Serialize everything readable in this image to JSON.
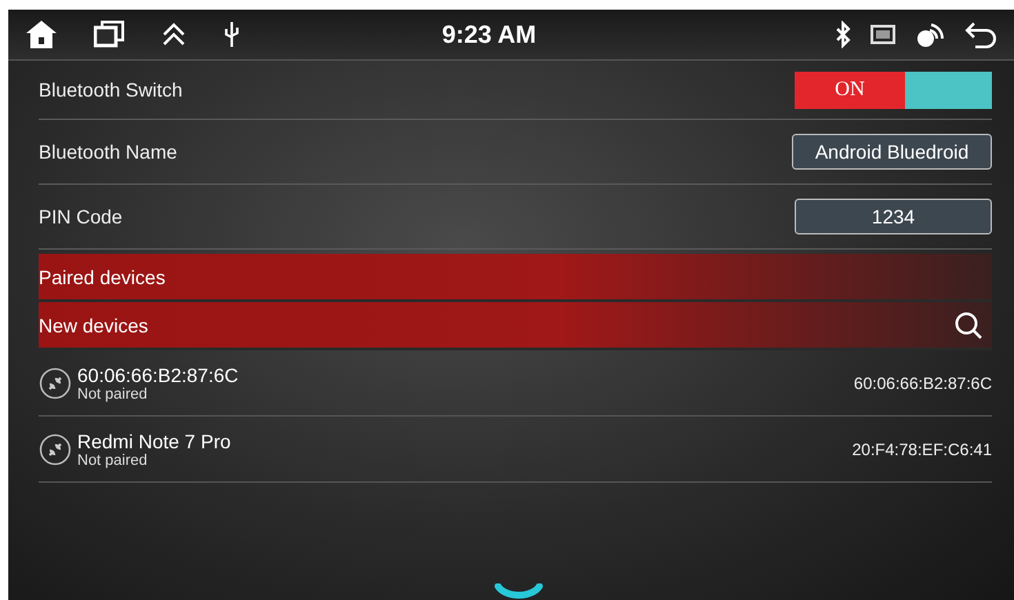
{
  "status_bar": {
    "time": "9:23 AM"
  },
  "settings": [
    {
      "kind": "switch",
      "label": "Bluetooth Switch",
      "on": true,
      "state_text": "ON"
    },
    {
      "kind": "field",
      "label": "Bluetooth Name",
      "value": "Android Bluedroid"
    },
    {
      "kind": "field",
      "label": "PIN Code",
      "value": "1234"
    }
  ],
  "sections": [
    {
      "title": "Paired devices",
      "search": false
    },
    {
      "title": "New devices",
      "search": true
    }
  ],
  "devices": [
    {
      "name": "60:06:66:B2:87:6C",
      "status": "Not paired",
      "address": "60:06:66:B2:87:6C"
    },
    {
      "name": "Redmi Note 7 Pro",
      "status": "Not paired",
      "address": "20:F4:78:EF:C6:41"
    }
  ]
}
